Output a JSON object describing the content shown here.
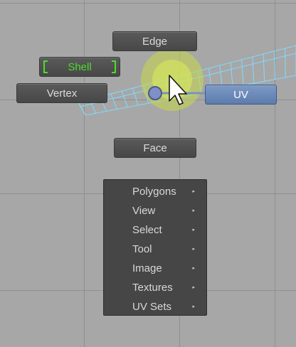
{
  "marking_menu": {
    "edge_label": "Edge",
    "shell_label": "Shell",
    "vertex_label": "Vertex",
    "uv_label": "UV",
    "face_label": "Face"
  },
  "context_menu": {
    "items": [
      {
        "label": "Polygons"
      },
      {
        "label": "View"
      },
      {
        "label": "Select"
      },
      {
        "label": "Tool"
      },
      {
        "label": "Image"
      },
      {
        "label": "Textures"
      },
      {
        "label": "UV Sets"
      }
    ],
    "submenu_arrow": "▸"
  },
  "colors": {
    "background": "#a7a7a7",
    "uv_mesh": "#7fdcff",
    "shell_text": "#4ddc2e",
    "uv_highlight": "#6e8fc0"
  },
  "icons": {
    "cursor": "arrow-cursor-icon",
    "highlight": "yellow-cursor-halo-icon",
    "center": "marking-menu-center-icon"
  }
}
